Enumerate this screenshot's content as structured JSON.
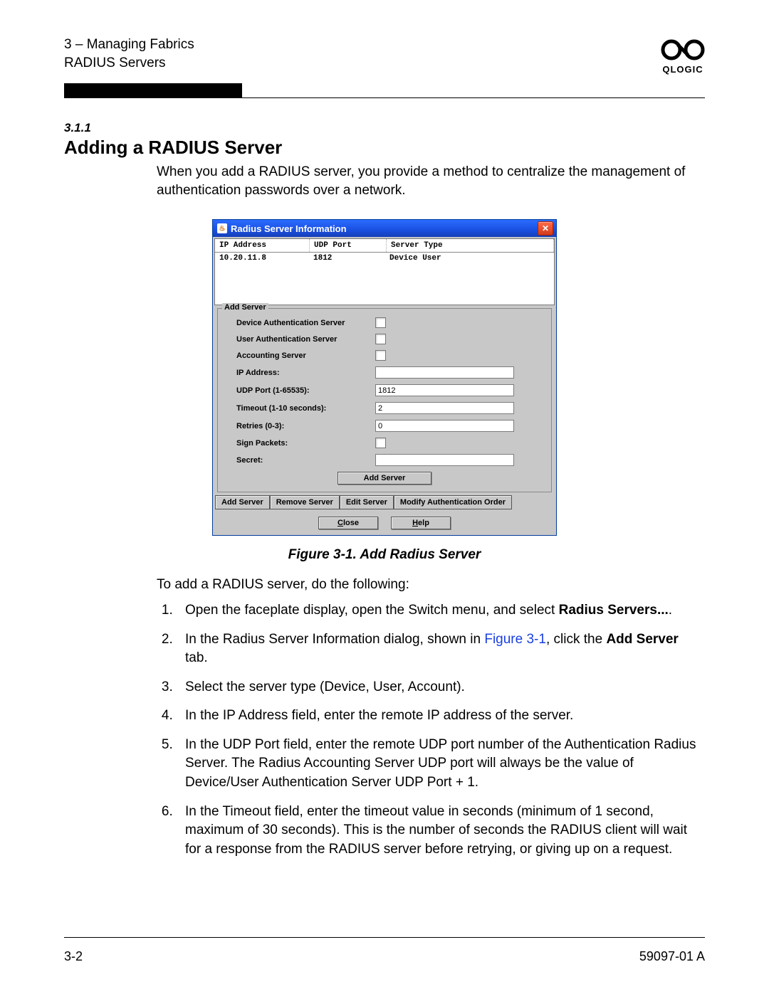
{
  "header": {
    "chapter_line": "3 – Managing Fabrics",
    "section_line": "RADIUS Servers",
    "logo_text": "QLOGIC"
  },
  "section": {
    "number": "3.1.1",
    "title": "Adding a RADIUS Server",
    "intro": "When you add a RADIUS server, you provide a method to centralize the management of authentication passwords over a network."
  },
  "dialog": {
    "title": "Radius Server Information",
    "columns": {
      "c1": "IP Address",
      "c2": "UDP Port",
      "c3": "Server Type"
    },
    "row": {
      "ip": "10.20.11.8",
      "port": "1812",
      "type": "Device  User"
    },
    "fieldset_legend": "Add Server",
    "labels": {
      "device_auth": "Device Authentication Server",
      "user_auth": "User Authentication Server",
      "accounting": "Accounting Server",
      "ip": "IP Address:",
      "udp": "UDP Port (1-65535):",
      "timeout": "Timeout (1-10 seconds):",
      "retries": "Retries (0-3):",
      "sign": "Sign Packets:",
      "secret": "Secret:"
    },
    "values": {
      "ip": "",
      "udp": "1812",
      "timeout": "2",
      "retries": "0",
      "secret": ""
    },
    "add_btn": "Add Server",
    "tabs": {
      "add": "Add Server",
      "remove": "Remove Server",
      "edit": "Edit Server",
      "modify": "Modify Authentication Order"
    },
    "close": "Close",
    "close_key": "C",
    "help": "Help",
    "help_key": "H"
  },
  "figure_caption": "Figure 3-1.  Add Radius Server",
  "lead": "To add a RADIUS server, do the following:",
  "steps": {
    "s1a": "Open the faceplate display, open the Switch menu, and select ",
    "s1b": "Radius Servers...",
    "s1c": ".",
    "s2a": "In the Radius Server Information dialog, shown in ",
    "s2link": "Figure 3-1",
    "s2b": ", click the ",
    "s2bold": "Add Server",
    "s2c": " tab.",
    "s3": "Select the server type (Device, User, Account).",
    "s4": "In the IP Address field, enter the remote IP address of the server.",
    "s5": "In the UDP Port field, enter the remote UDP port number of the Authentication Radius Server. The Radius Accounting Server UDP port will always be the value of Device/User Authentication Server UDP Port + 1.",
    "s6": "In the Timeout field, enter the timeout value in seconds (minimum of 1 second, maximum of 30 seconds). This is the number of seconds the RADIUS client will wait for a response from the RADIUS server before retrying, or giving up on a request."
  },
  "footer": {
    "page": "3-2",
    "doc": "59097-01 A"
  }
}
